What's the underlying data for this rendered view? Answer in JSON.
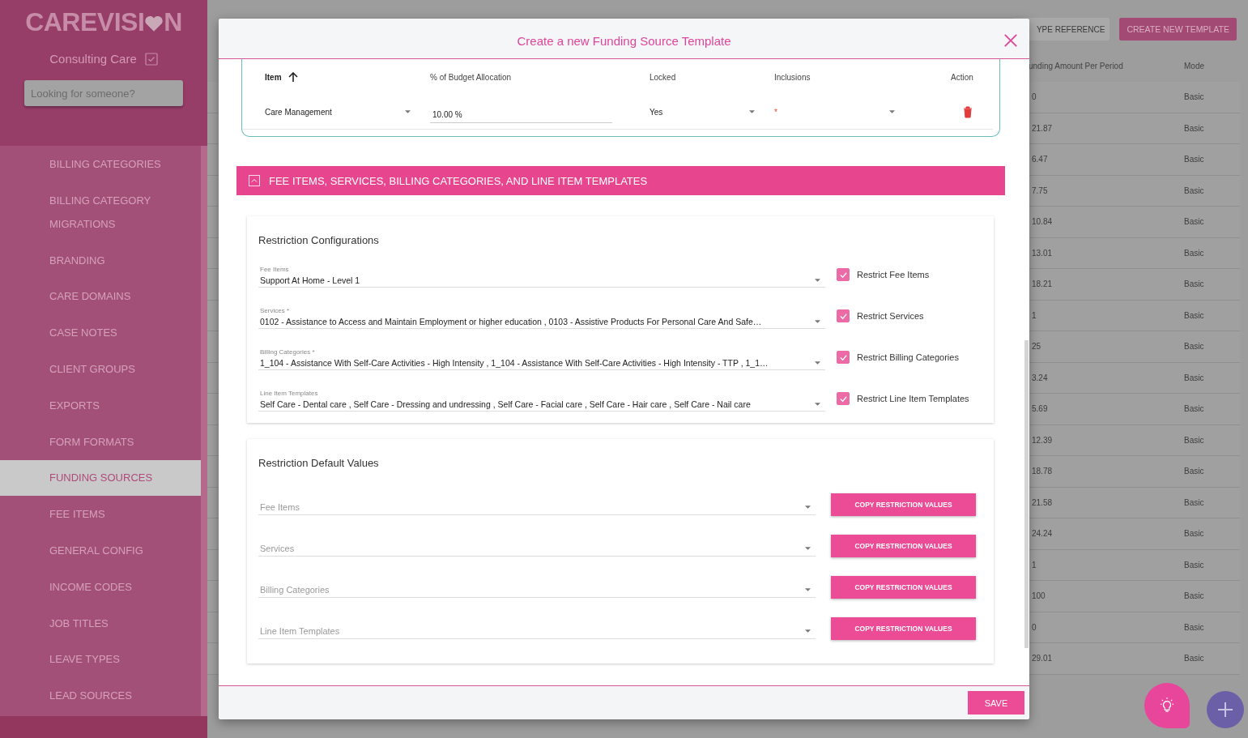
{
  "sidebar": {
    "logo": {
      "before": "CAREVISI",
      "after": "N"
    },
    "organization": "Consulting Care",
    "search": {
      "placeholder": "Looking for someone?"
    },
    "items": [
      {
        "label": "BILLING CATEGORIES",
        "selected": false
      },
      {
        "label": "BILLING CATEGORY MIGRATIONS",
        "selected": false
      },
      {
        "label": "BRANDING",
        "selected": false
      },
      {
        "label": "CARE DOMAINS",
        "selected": false
      },
      {
        "label": "CASE NOTES",
        "selected": false
      },
      {
        "label": "CLIENT GROUPS",
        "selected": false
      },
      {
        "label": "EXPORTS",
        "selected": false
      },
      {
        "label": "FORM FORMATS",
        "selected": false
      },
      {
        "label": "FUNDING SOURCES",
        "selected": true
      },
      {
        "label": "FEE ITEMS",
        "selected": false
      },
      {
        "label": "GENERAL CONFIG",
        "selected": false
      },
      {
        "label": "INCOME CODES",
        "selected": false
      },
      {
        "label": "JOB TITLES",
        "selected": false
      },
      {
        "label": "LEAVE TYPES",
        "selected": false
      },
      {
        "label": "LEAD SOURCES",
        "selected": false
      }
    ]
  },
  "background_page": {
    "buttons": [
      "YPE REFERENCE",
      "CREATE NEW TEMPLATE"
    ],
    "table": {
      "columns": [
        "unding Amount Per Period",
        "Mode"
      ],
      "rows": [
        [
          "0",
          "Basic"
        ],
        [
          "21.87",
          "Basic"
        ],
        [
          "6.47",
          "Basic"
        ],
        [
          "7.75",
          "Basic"
        ],
        [
          "10.84",
          "Basic"
        ],
        [
          "13.01",
          "Basic"
        ],
        [
          "18.21",
          "Basic"
        ],
        [
          "1",
          "Basic"
        ],
        [
          "25",
          "Basic"
        ],
        [
          "3.24",
          "Basic"
        ],
        [
          "5.69",
          "Basic"
        ],
        [
          "12.39",
          "Basic"
        ],
        [
          "18.78",
          "Basic"
        ],
        [
          "21.58",
          "Basic"
        ],
        [
          "24.24",
          "Basic"
        ],
        [
          "1",
          "Basic"
        ],
        [
          "100",
          "Basic"
        ],
        [
          "0",
          "Basic"
        ],
        [
          "29.01",
          "Basic"
        ]
      ]
    }
  },
  "modal": {
    "title": "Create a new Funding Source Template",
    "allocation_table": {
      "columns": [
        {
          "label": "Item",
          "sorted": true
        },
        {
          "label": "% of Budget Allocation",
          "sorted": false
        },
        {
          "label": "Locked",
          "sorted": false
        },
        {
          "label": "Inclusions",
          "sorted": false
        },
        {
          "label": "Action",
          "sorted": false
        }
      ],
      "rows": [
        {
          "item": "Care Management",
          "allocation": "10.00 %",
          "locked": "Yes",
          "inclusions": "*"
        }
      ]
    },
    "section": {
      "title": "FEE ITEMS, SERVICES, BILLING CATEGORIES, AND LINE ITEM TEMPLATES",
      "expanded": true
    },
    "restriction_configurations": {
      "title": "Restriction Configurations",
      "fields": [
        {
          "label": "Fee Items",
          "value": "Support At Home - Level 1",
          "checkbox_label": "Restrict Fee Items",
          "checked": true
        },
        {
          "label": "Services *",
          "value": "0102 - Assistance to Access and Maintain Employment or higher education , 0103 - Assistive Products For Personal Care And Safe…",
          "checkbox_label": "Restrict Services",
          "checked": true
        },
        {
          "label": "Billing Categories *",
          "value": "1_104 - Assistance With Self-Care Activities - High Intensity , 1_104 - Assistance With Self-Care Activities - High Intensity - TTP , 1_1…",
          "checkbox_label": "Restrict Billing Categories",
          "checked": true
        },
        {
          "label": "Line Item Templates",
          "value": "Self Care - Dental care , Self Care - Dressing and undressing , Self Care - Facial care , Self Care - Hair care , Self Care - Nail care",
          "checkbox_label": "Restrict Line Item Templates",
          "checked": true
        }
      ]
    },
    "restriction_defaults": {
      "title": "Restriction Default Values",
      "fields": [
        {
          "placeholder": "Fee Items",
          "button": "COPY RESTRICTION VALUES"
        },
        {
          "placeholder": "Services",
          "button": "COPY RESTRICTION VALUES"
        },
        {
          "placeholder": "Billing Categories",
          "button": "COPY RESTRICTION VALUES"
        },
        {
          "placeholder": "Line Item Templates",
          "button": "COPY RESTRICTION VALUES"
        }
      ]
    },
    "save_button": "SAVE"
  }
}
